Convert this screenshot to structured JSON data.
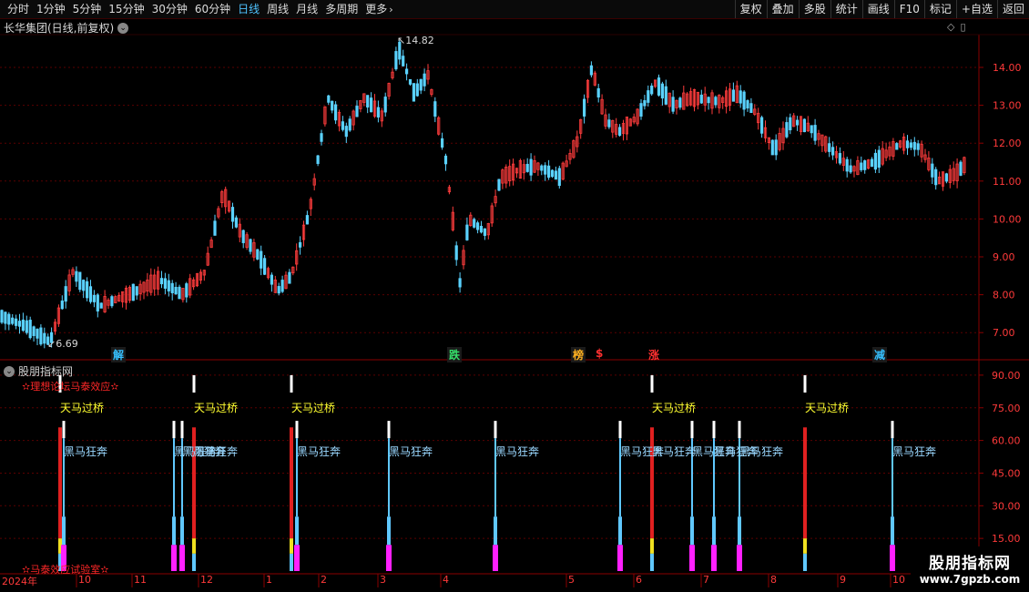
{
  "toolbar": {
    "periods": [
      "分时",
      "1分钟",
      "5分钟",
      "15分钟",
      "30分钟",
      "60分钟",
      "日线",
      "周线",
      "月线",
      "多周期",
      "更多"
    ],
    "active_period": "日线",
    "right_buttons": [
      "复权",
      "叠加",
      "多股",
      "统计",
      "画线",
      "F10",
      "标记",
      "+自选",
      "返回"
    ]
  },
  "stock": {
    "title": "长华集团(日线,前复权)"
  },
  "price_axis": {
    "ticks": [
      "14.00",
      "13.00",
      "12.00",
      "11.00",
      "10.00",
      "9.00",
      "8.00",
      "7.00"
    ]
  },
  "price_marks": {
    "high": "14.82",
    "low": "6.69"
  },
  "event_tags": [
    {
      "text": "解",
      "color": "#35c0ff"
    },
    {
      "text": "跌",
      "color": "#35e06a"
    },
    {
      "text": "榜",
      "color": "#ffb020"
    },
    {
      "text": "$",
      "color": "#ff3030"
    },
    {
      "text": "涨",
      "color": "#ff3030"
    },
    {
      "text": "减",
      "color": "#35c0ff"
    }
  ],
  "indicator": {
    "title": "股朋指标网",
    "subtitle_top": "✫理想论坛马泰效应✫",
    "subtitle_bottom": "✫马泰效应试验室✫",
    "ticks": [
      "90.00",
      "75.00",
      "60.00",
      "45.00",
      "30.00",
      "15.00"
    ],
    "label_sky": "天马过桥",
    "label_dark": "黑马狂奔"
  },
  "dates": [
    "2024年",
    "10",
    "11",
    "12",
    "1",
    "2",
    "3",
    "4",
    "5",
    "6",
    "7",
    "8",
    "9",
    "10",
    "1"
  ],
  "watermark": {
    "line1": "股朋指标网",
    "line2": "www.7gpzb.com"
  },
  "colors": {
    "up": "#ff3c3c",
    "down": "#5ad2ff",
    "grid": "#5a0000",
    "axis": "#8a0000"
  }
}
